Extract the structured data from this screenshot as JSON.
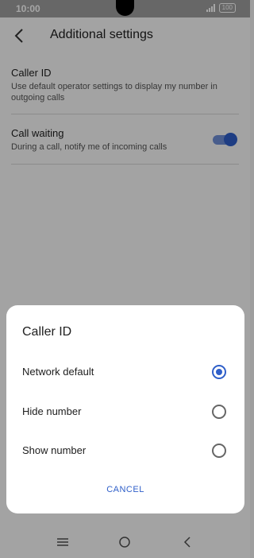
{
  "status_bar": {
    "time": "10:00",
    "battery": "100"
  },
  "header": {
    "title": "Additional settings"
  },
  "settings": [
    {
      "title": "Caller ID",
      "description": "Use default operator settings to display my number in outgoing calls"
    },
    {
      "title": "Call waiting",
      "description": "During a call, notify me of incoming calls",
      "toggle_on": true
    }
  ],
  "dialog": {
    "title": "Caller ID",
    "options": [
      {
        "label": "Network default",
        "selected": true
      },
      {
        "label": "Hide number",
        "selected": false
      },
      {
        "label": "Show number",
        "selected": false
      }
    ],
    "cancel_label": "CANCEL"
  },
  "colors": {
    "accent": "#2f5fc9",
    "overlay": "rgba(0,0,0,0.35)"
  }
}
